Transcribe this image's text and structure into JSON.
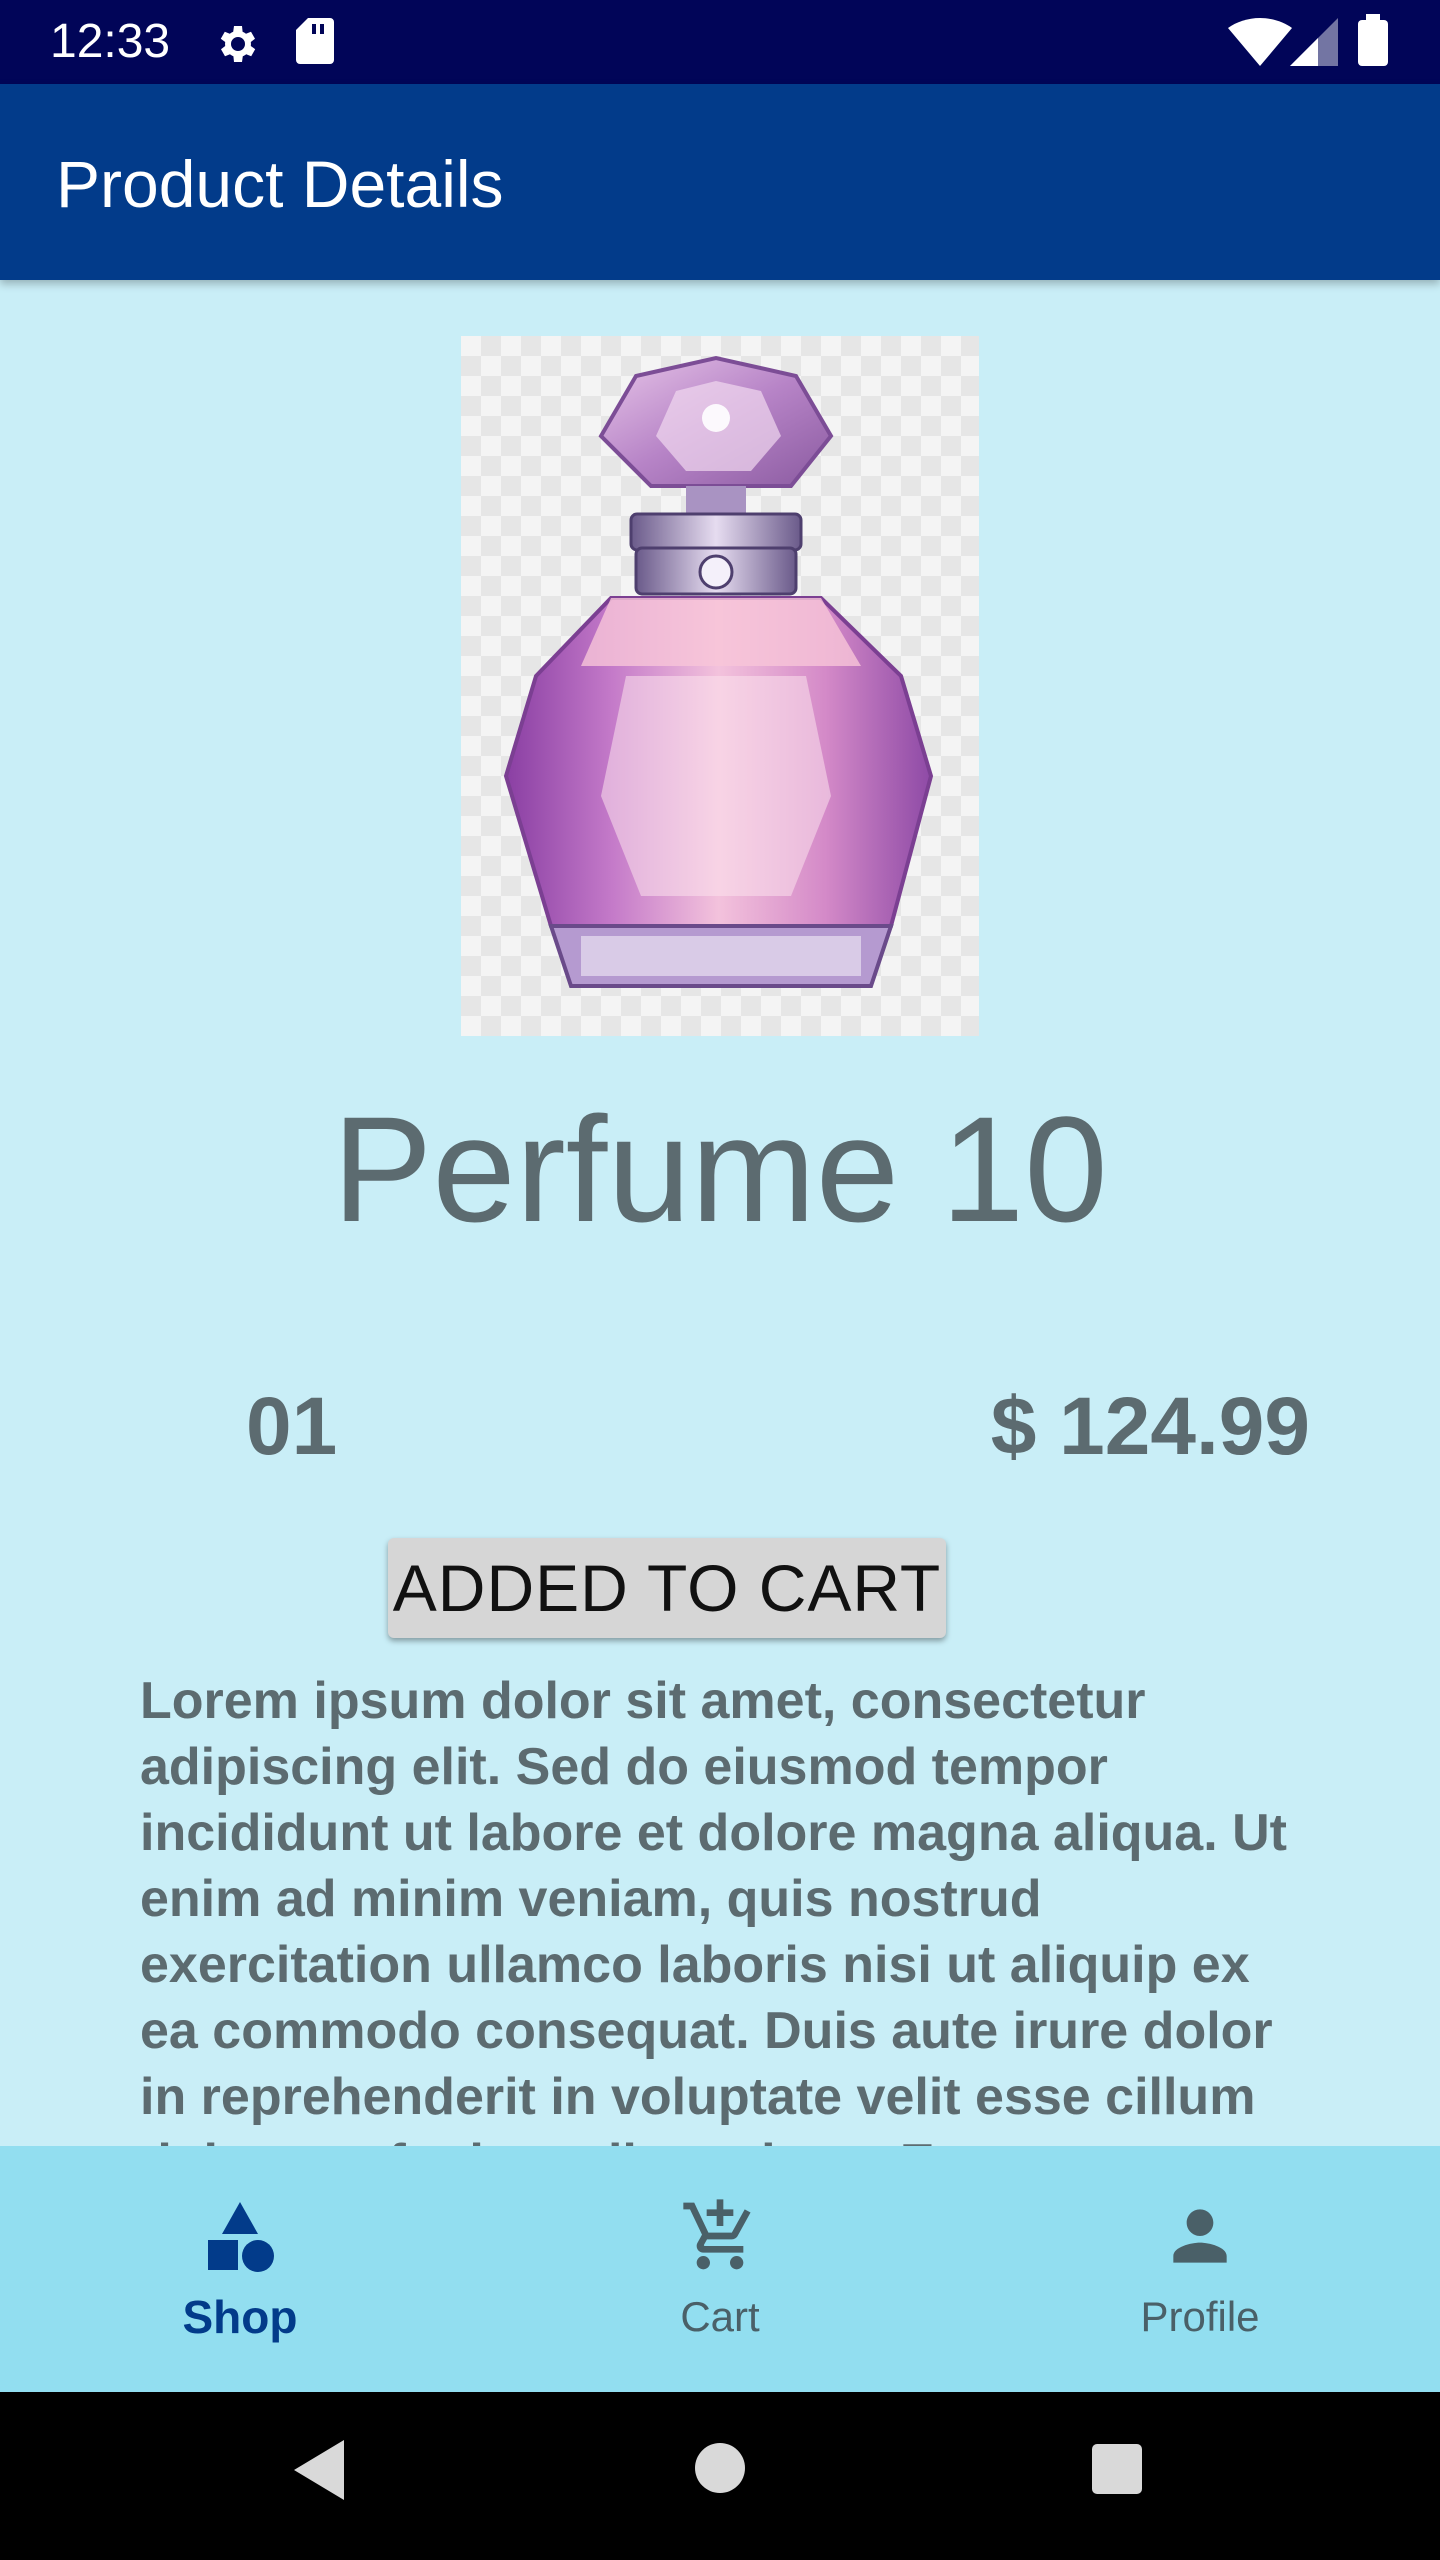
{
  "status_bar": {
    "time": "12:33",
    "icons": [
      "gear-icon",
      "sd-card-icon",
      "wifi-icon",
      "signal-icon",
      "battery-icon"
    ]
  },
  "app_bar": {
    "title": "Product Details"
  },
  "product": {
    "image_icon": "perfume-bottle-image",
    "name": "Perfume 10",
    "quantity": "01",
    "price": "$ 124.99",
    "cart_button_label": "ADDED TO CART",
    "description": "Lorem ipsum dolor sit amet, consectetur adipiscing elit. Sed do eiusmod tempor incididunt ut labore et dolore magna aliqua. Ut enim ad minim veniam, quis nostrud exercitation ullamco laboris nisi ut aliquip ex ea commodo consequat. Duis aute irure dolor in reprehenderit in voluptate velit esse cillum dolore eu fugiat nulla pariatur. Excepteur"
  },
  "bottom_nav": {
    "items": [
      {
        "label": "Shop",
        "icon": "shapes-icon",
        "active": true
      },
      {
        "label": "Cart",
        "icon": "add-shopping-cart-icon",
        "active": false
      },
      {
        "label": "Profile",
        "icon": "person-icon",
        "active": false
      }
    ]
  },
  "system_nav": {
    "icons": [
      "back-icon",
      "home-icon",
      "recents-icon"
    ]
  },
  "colors": {
    "status_bar": "#010558",
    "app_bar": "#023b8a",
    "background": "#c9eef7",
    "bottom_nav": "#92def0",
    "text_muted": "#5c6b70",
    "active_nav": "#023b8a"
  }
}
